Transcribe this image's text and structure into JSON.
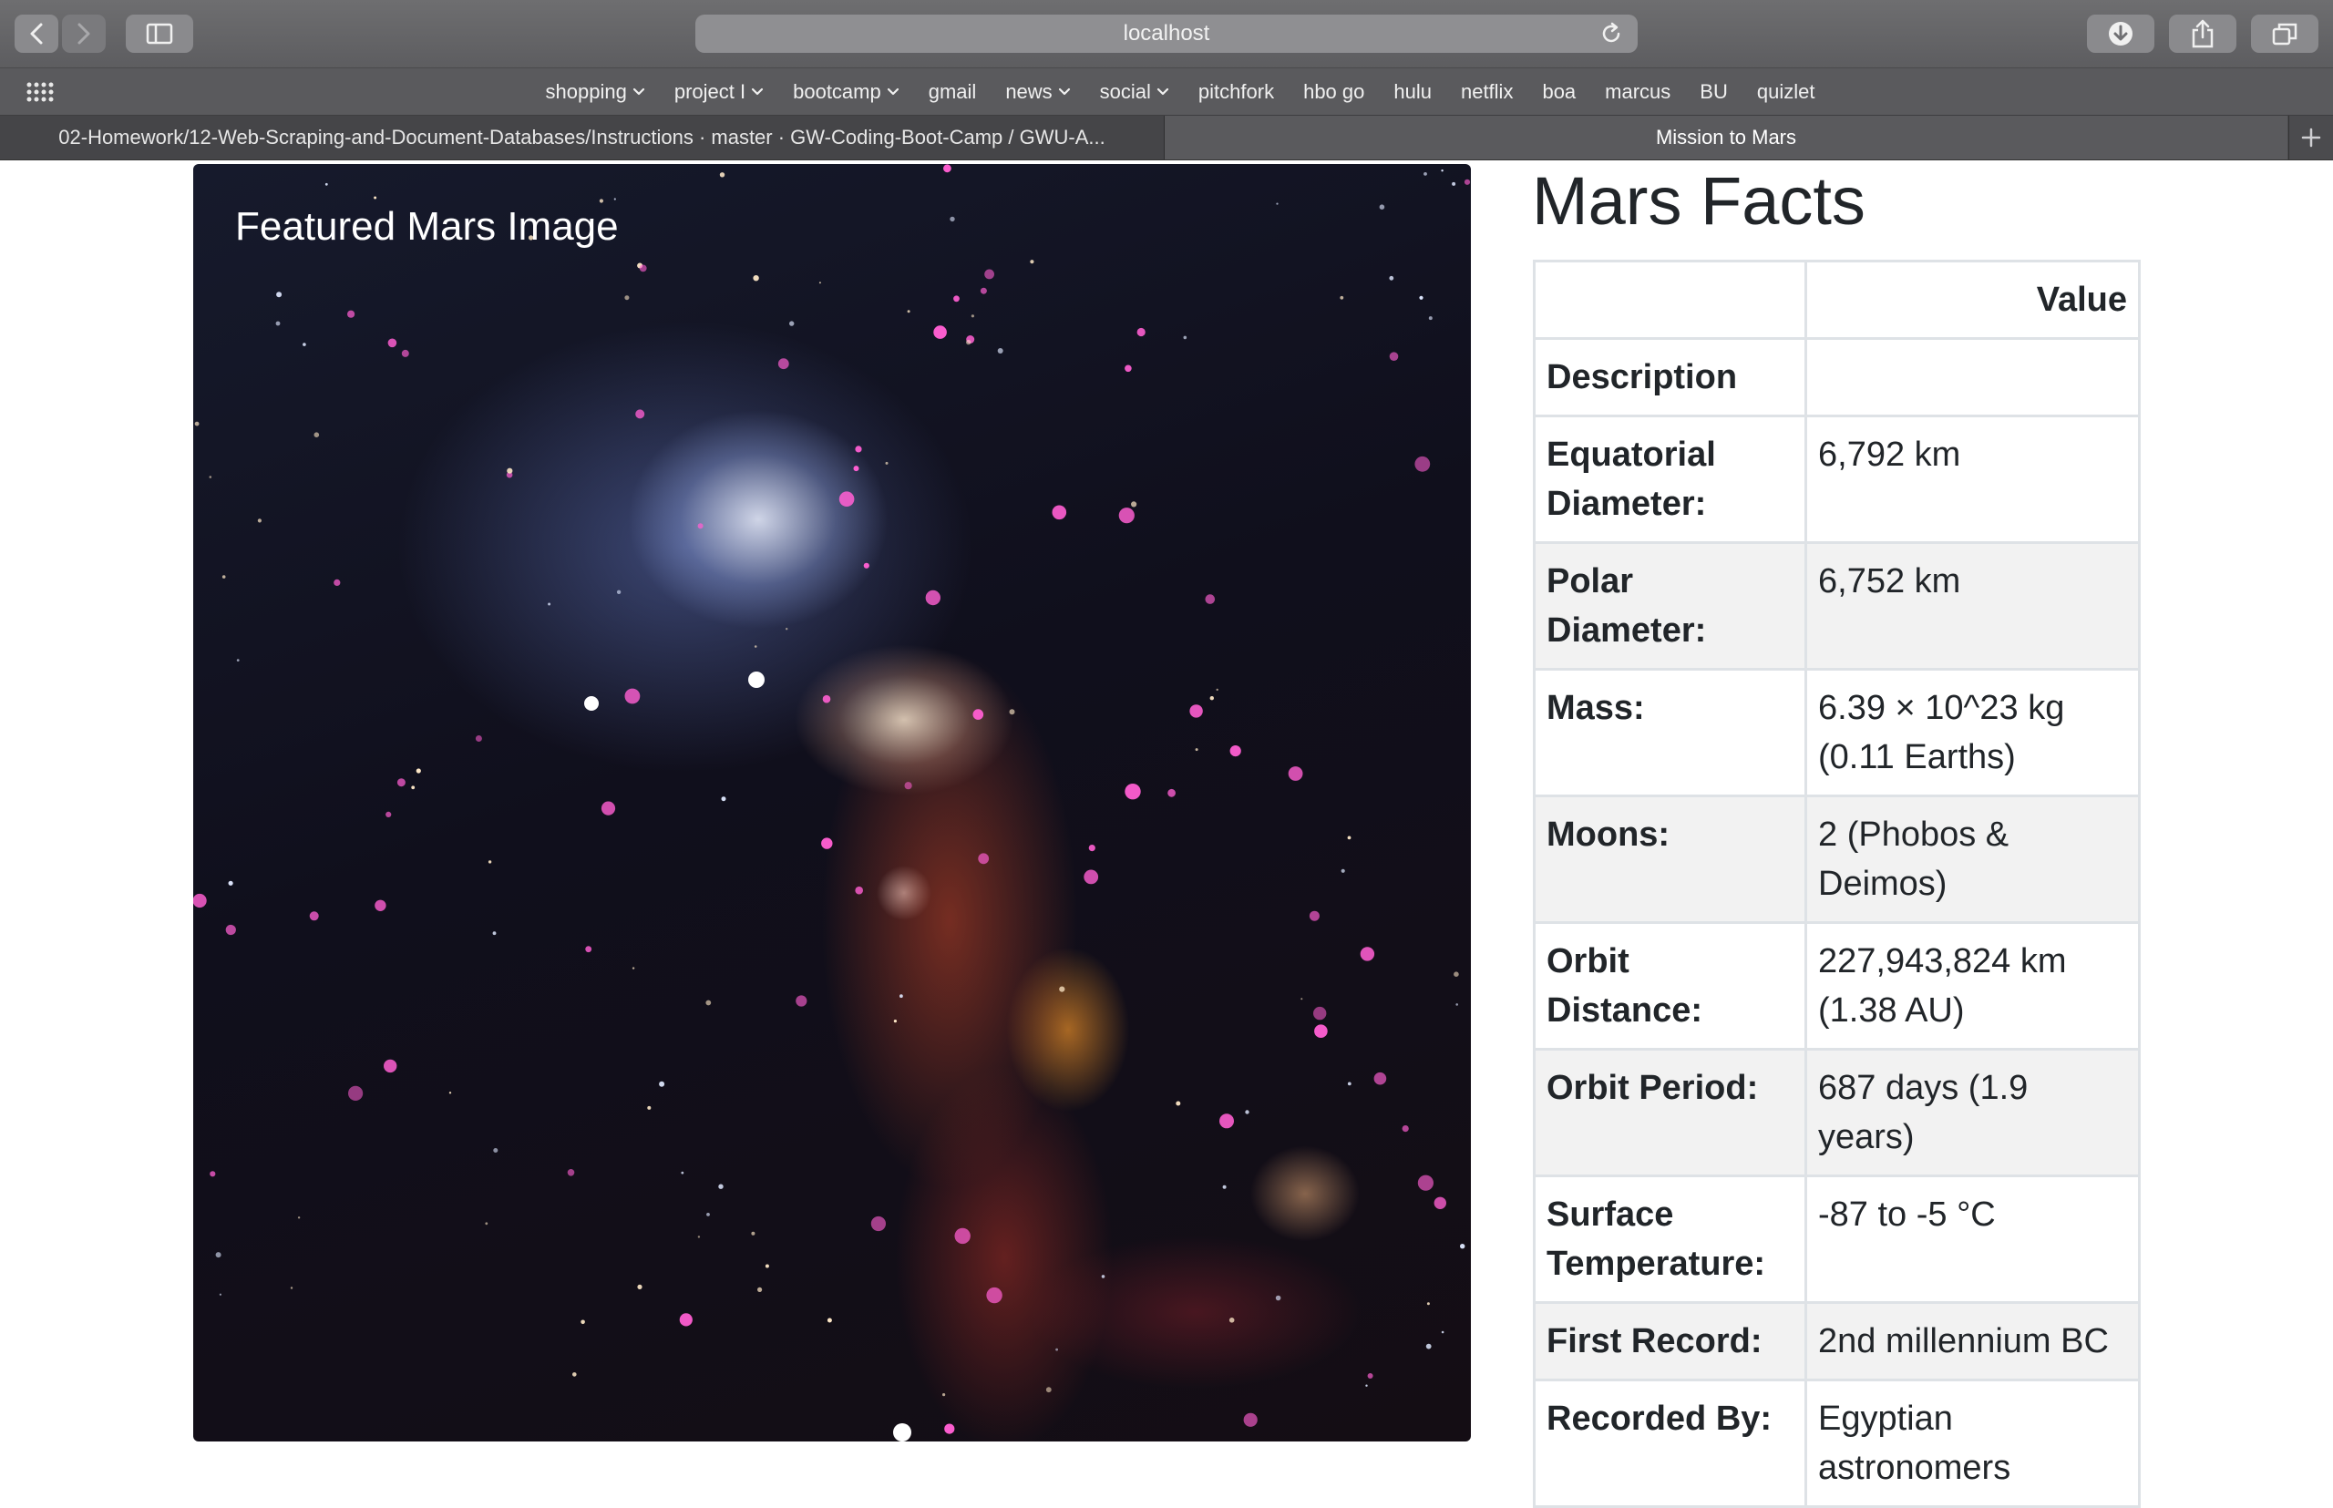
{
  "browser": {
    "url": "localhost",
    "bookmarks": [
      {
        "label": "shopping",
        "menu": true
      },
      {
        "label": "project I",
        "menu": true
      },
      {
        "label": "bootcamp",
        "menu": true
      },
      {
        "label": "gmail",
        "menu": false
      },
      {
        "label": "news",
        "menu": true
      },
      {
        "label": "social",
        "menu": true
      },
      {
        "label": "pitchfork",
        "menu": false
      },
      {
        "label": "hbo go",
        "menu": false
      },
      {
        "label": "hulu",
        "menu": false
      },
      {
        "label": "netflix",
        "menu": false
      },
      {
        "label": "boa",
        "menu": false
      },
      {
        "label": "marcus",
        "menu": false
      },
      {
        "label": "BU",
        "menu": false
      },
      {
        "label": "quizlet",
        "menu": false
      }
    ],
    "tabs": [
      {
        "title": "02-Homework/12-Web-Scraping-and-Document-Databases/Instructions · master · GW-Coding-Boot-Camp / GWU-A...",
        "active": false
      },
      {
        "title": "Mission to Mars",
        "active": true
      }
    ]
  },
  "featured": {
    "title": "Featured Mars Image"
  },
  "facts": {
    "title": "Mars Facts",
    "header": {
      "col1": "",
      "col2": "Value"
    },
    "rows": [
      {
        "label": "Description",
        "value": ""
      },
      {
        "label": "Equatorial Diameter:",
        "value": "6,792 km"
      },
      {
        "label": "Polar Diameter:",
        "value": "6,752 km"
      },
      {
        "label": "Mass:",
        "value": "6.39 × 10^23 kg (0.11 Earths)"
      },
      {
        "label": "Moons:",
        "value": "2 (Phobos & Deimos)"
      },
      {
        "label": "Orbit Distance:",
        "value": "227,943,824 km (1.38 AU)"
      },
      {
        "label": "Orbit Period:",
        "value": "687 days (1.9 years)"
      },
      {
        "label": "Surface Temperature:",
        "value": "-87 to -5 °C"
      },
      {
        "label": "First Record:",
        "value": "2nd millennium BC"
      },
      {
        "label": "Recorded By:",
        "value": "Egyptian astronomers"
      }
    ]
  }
}
